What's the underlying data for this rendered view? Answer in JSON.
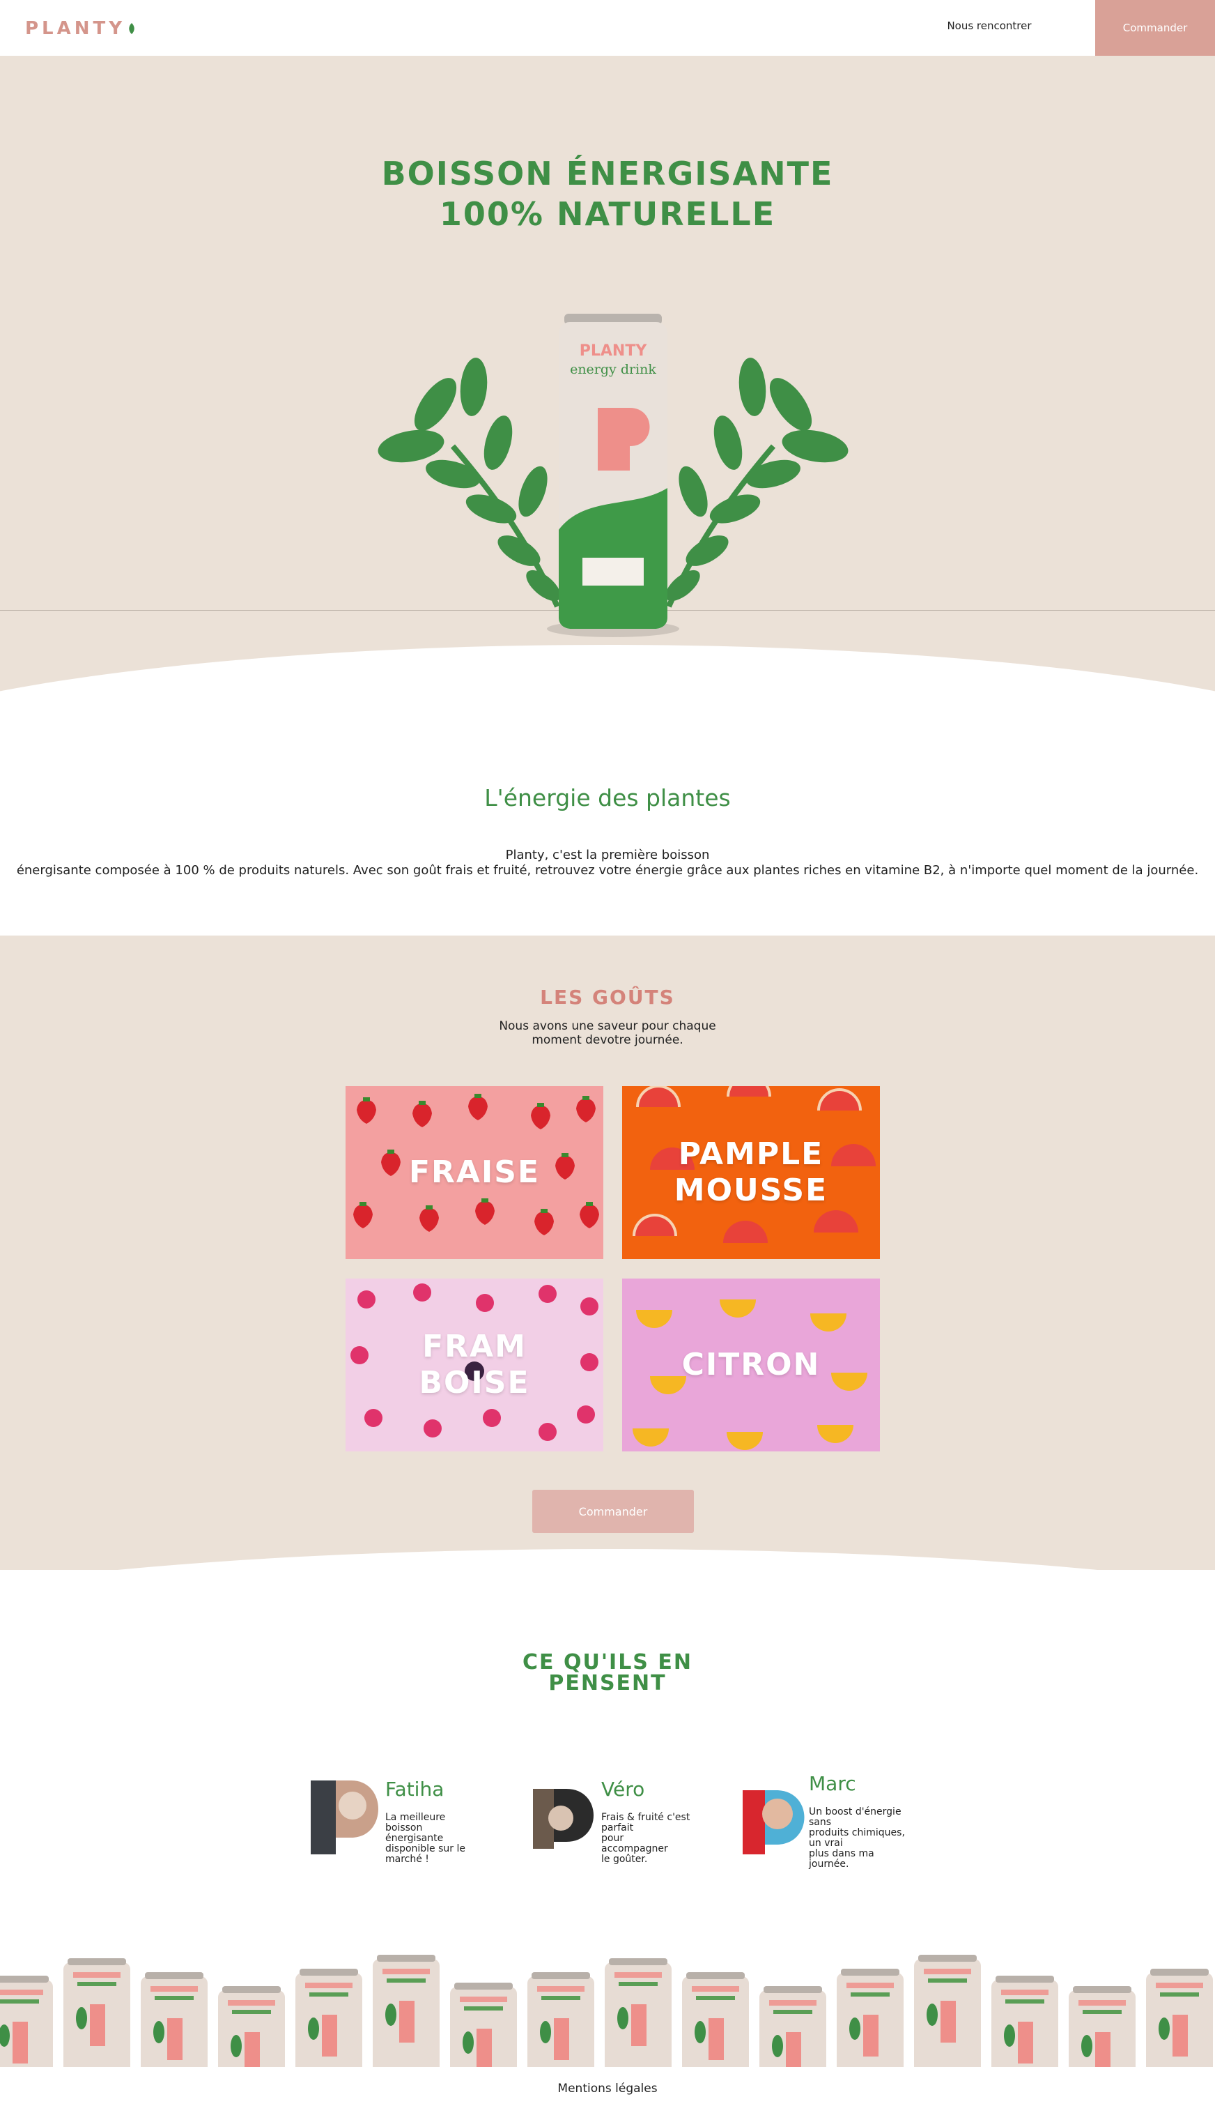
{
  "header": {
    "logo": "PLANTY",
    "nav_link": "Nous rencontrer",
    "cta": "Commander"
  },
  "hero": {
    "title_line1": "BOISSON ÉNERGISANTE",
    "title_line2": "100% NATURELLE",
    "can_brand": "PLANTY",
    "can_subtitle": "energy drink",
    "can_letter": "P"
  },
  "intro": {
    "title": "L'énergie des plantes",
    "text_line1": "Planty, c'est la première boisson",
    "text_line2": "énergisante composée à 100 % de produits naturels. Avec son goût frais et fruité, retrouvez votre énergie grâce aux plantes riches en vitamine B2, à n'importe quel moment de la journée."
  },
  "tastes": {
    "title": "LES GOÛTS",
    "subtitle_line1": "Nous avons une saveur pour chaque",
    "subtitle_line2": "moment devotre journée.",
    "flavors": [
      {
        "line1": "FRAISE",
        "line2": "",
        "bg": "#f3a0a0"
      },
      {
        "line1": "PAMPLE",
        "line2": "MOUSSE",
        "bg": "#f2620f"
      },
      {
        "line1": "FRAM",
        "line2": "BOISE",
        "bg": "#f2cfe6"
      },
      {
        "line1": "CITRON",
        "line2": "",
        "bg": "#e9a6d9"
      }
    ],
    "button": "Commander"
  },
  "reviews": {
    "title_line1": "CE QU'ILS EN",
    "title_line2": "PENSENT",
    "items": [
      {
        "name": "Fatiha",
        "text": [
          "La meilleure",
          "boisson",
          "énergisante",
          "disponible sur le",
          "marché !"
        ]
      },
      {
        "name": "Véro",
        "text": [
          "Frais & fruité c'est",
          "parfait",
          "pour",
          "accompagner",
          "le goûter."
        ]
      },
      {
        "name": "Marc",
        "text": [
          "Un boost d'énergie",
          "sans",
          "produits chimiques,",
          "un vrai",
          "plus dans ma",
          "journée."
        ]
      }
    ]
  },
  "footer": {
    "link": "Mentions légales"
  },
  "colors": {
    "green": "#3f8f46",
    "pink": "#d9a197",
    "beige": "#ebe1d7"
  }
}
